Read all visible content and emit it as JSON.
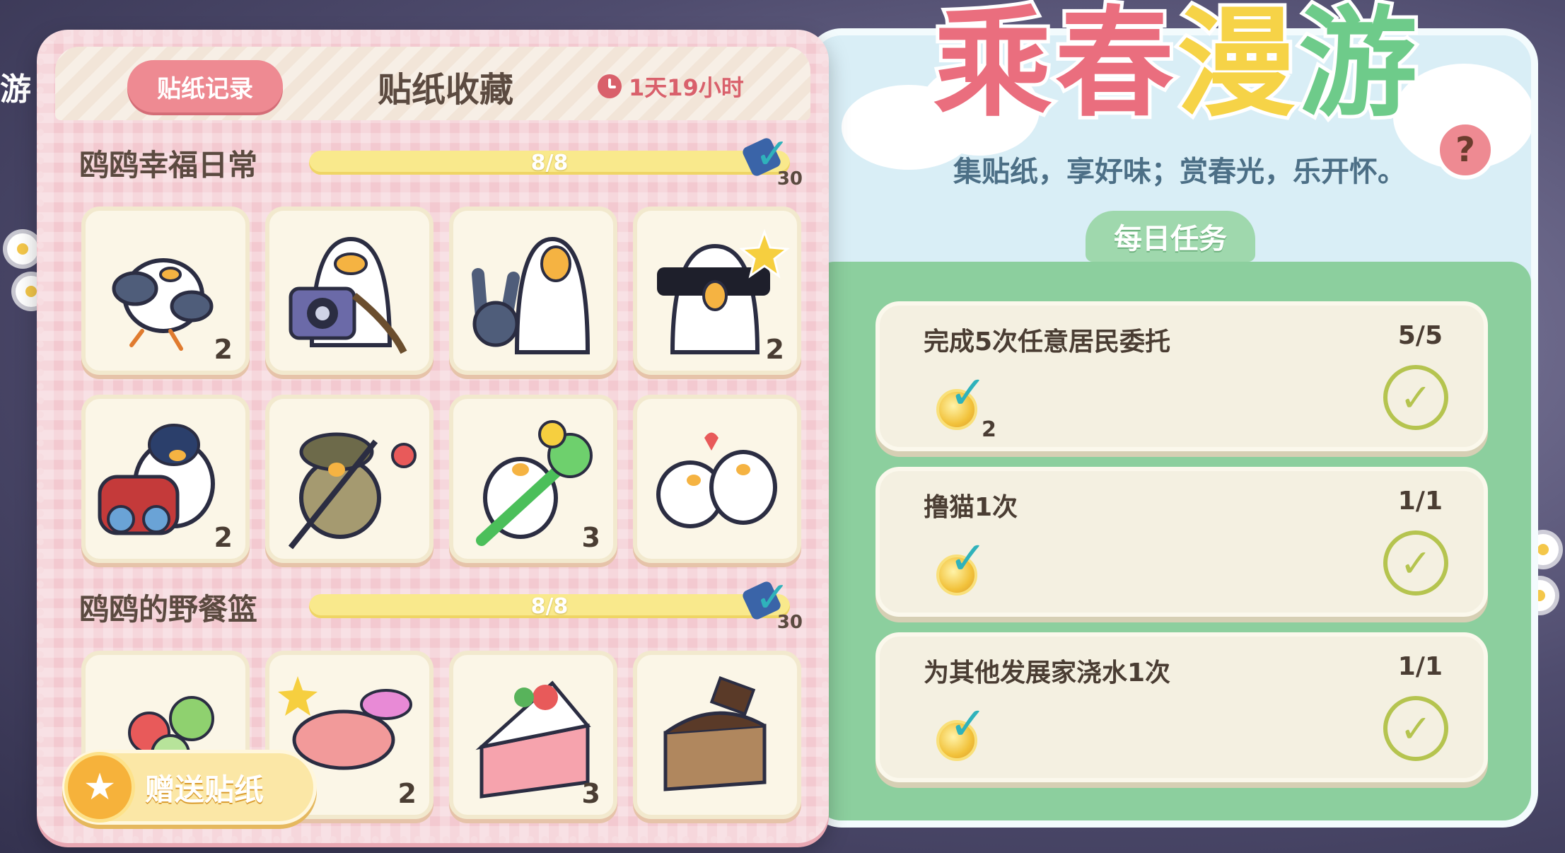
{
  "left_panel": {
    "tab_record_label": "贴纸记录",
    "title": "贴纸收藏",
    "timer": "1天19小时",
    "sections": [
      {
        "title": "鸥鸥幸福日常",
        "progress": "8/8",
        "reward_count": "30",
        "stickers": [
          {
            "name": "stretching gull",
            "count": "2"
          },
          {
            "name": "camera gull",
            "count": ""
          },
          {
            "name": "peace sign gull",
            "count": ""
          },
          {
            "name": "sunglasses gull",
            "count": "2"
          },
          {
            "name": "binoculars gull",
            "count": "2"
          },
          {
            "name": "fishing gull",
            "count": ""
          },
          {
            "name": "flower gull",
            "count": "3"
          },
          {
            "name": "love gulls",
            "count": ""
          }
        ]
      },
      {
        "title": "鸥鸥的野餐篮",
        "progress": "8/8",
        "reward_count": "30",
        "stickers": [
          {
            "name": "salad",
            "count": ""
          },
          {
            "name": "macaron",
            "count": "2"
          },
          {
            "name": "strawberry cake",
            "count": "3"
          },
          {
            "name": "chocolate cake",
            "count": ""
          }
        ]
      }
    ],
    "gift_button_label": "赠送贴纸"
  },
  "right_panel": {
    "logo_chars": [
      "乘",
      "春",
      "漫",
      "游"
    ],
    "subtitle": "集贴纸，享好味；赏春光，乐开怀。",
    "help_label": "?",
    "daily_tab": "每日任务",
    "tasks": [
      {
        "name": "完成5次任意居民委托",
        "progress": "5/5",
        "reward_count": "2"
      },
      {
        "name": "撸猫1次",
        "progress": "1/1",
        "reward_count": ""
      },
      {
        "name": "为其他发展家浇水1次",
        "progress": "1/1",
        "reward_count": ""
      }
    ]
  },
  "side_text": "游",
  "colors": {
    "pink_panel": "#f3c9d0",
    "pink_button": "#ee8a92",
    "progress_yellow": "#f9e98c",
    "teal_check": "#2fb2bb",
    "green_band": "#8ccf9e",
    "sky_blue": "#d9eef6",
    "logo_pink": "#ea6e7e",
    "logo_yellow": "#f6d347",
    "logo_green": "#6ecb8a"
  },
  "icons": [
    "clock-icon",
    "check-icon",
    "help-icon",
    "gift-icon",
    "coin-icon"
  ]
}
